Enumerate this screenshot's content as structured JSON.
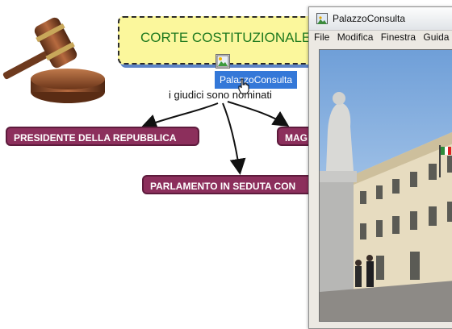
{
  "concept_map": {
    "title": "CORTE COSTITUZIONALE",
    "tooltip": "PalazzoConsulta",
    "linking_phrase": "i giudici sono nominati",
    "nodes": {
      "presidente": "PRESIDENTE DELLA REPUBBLICA",
      "magistrature": "MAG",
      "parlamento": "PARLAMENTO IN SEDUTA CON"
    },
    "colors": {
      "title_bg": "#fbf79c",
      "title_text": "#1f7a1f",
      "node_bg": "#8c2f5c",
      "tooltip_bg": "#3478d8"
    }
  },
  "viewer": {
    "title": "PalazzoConsulta",
    "menu": [
      "File",
      "Modifica",
      "Finestra",
      "Guida"
    ],
    "icon": "image-file-icon"
  }
}
